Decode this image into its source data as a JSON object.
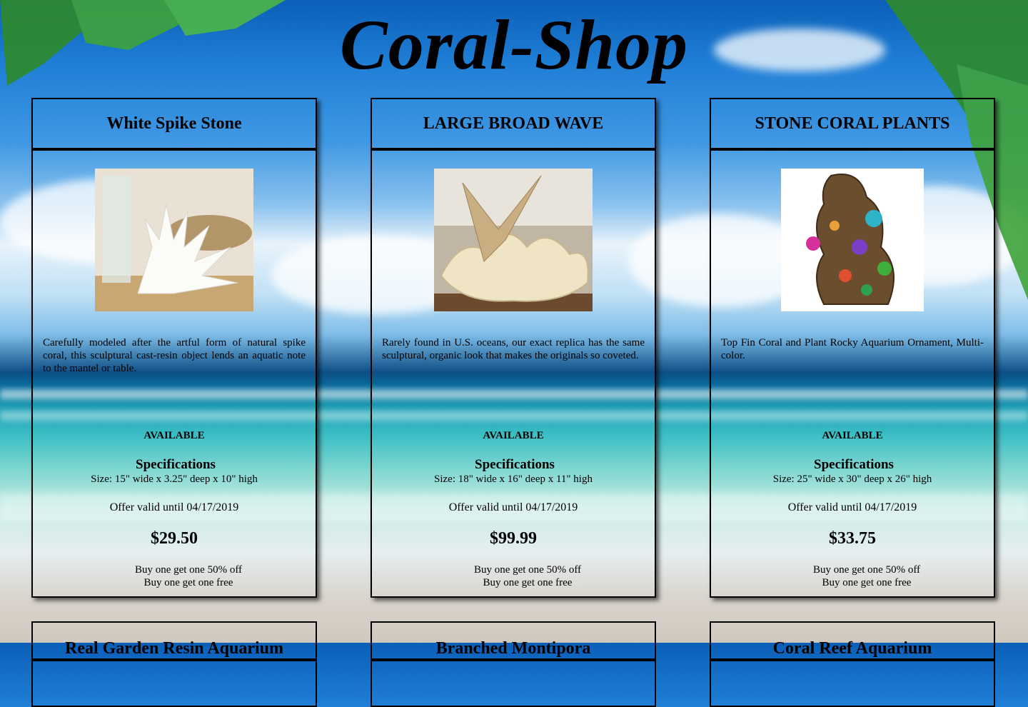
{
  "site": {
    "title": "Coral-Shop"
  },
  "products": [
    {
      "name": "White Spike Stone",
      "image_icon": "white-coral-image",
      "description": "Carefully modeled after the artful form of natural spike coral, this sculptural cast-resin object lends an aquatic note to the mantel or table.",
      "availability": "AVAILABLE",
      "spec_title": "Specifications",
      "size": "Size: 15\" wide x 3.25\" deep x 10\" high",
      "offer": "Offer valid until 04/17/2019",
      "price": "$29.50",
      "promo1": "Buy one get one 50% off",
      "promo2": "Buy one get one free"
    },
    {
      "name": "LARGE BROAD WAVE",
      "image_icon": "broad-wave-coral-image",
      "description": "Rarely found in U.S. oceans, our exact replica has the same sculptural, organic look that makes the originals so coveted.",
      "availability": "AVAILABLE",
      "spec_title": "Specifications",
      "size": "Size: 18\" wide x 16\" deep x 11\" high",
      "offer": "Offer valid until 04/17/2019",
      "price": "$99.99",
      "promo1": "Buy one get one 50% off",
      "promo2": "Buy one get one free"
    },
    {
      "name": "STONE CORAL PLANTS",
      "image_icon": "coral-rock-ornament-image",
      "description": "Top Fin Coral and Plant Rocky Aquarium Ornament, Multi-color.",
      "availability": "AVAILABLE",
      "spec_title": "Specifications",
      "size": "Size: 25\" wide x 30\" deep x 26\" high",
      "offer": "Offer valid until 04/17/2019",
      "price": "$33.75",
      "promo1": "Buy one get one 50% off",
      "promo2": "Buy one get one free"
    }
  ],
  "next_row": [
    {
      "name": "Real Garden Resin Aquarium"
    },
    {
      "name": "Branched Montipora"
    },
    {
      "name": "Coral Reef Aquarium"
    }
  ]
}
